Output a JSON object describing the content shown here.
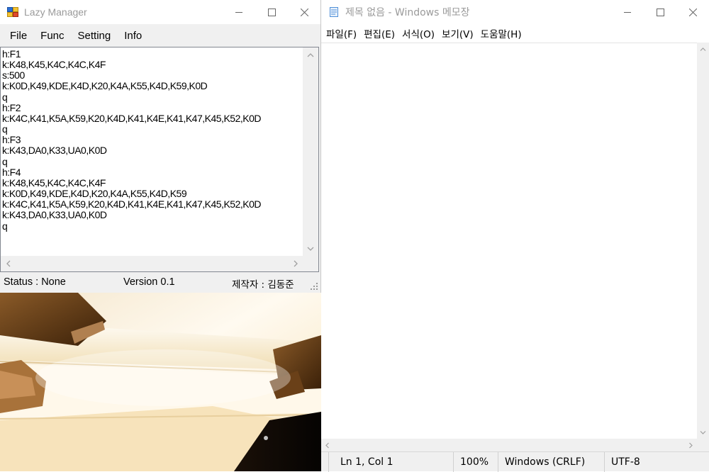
{
  "lazy_manager": {
    "title": "Lazy Manager",
    "menu": [
      "File",
      "Func",
      "Setting",
      "Info"
    ],
    "script_text": "h:F1\nk:K48,K45,K4C,K4C,K4F\ns:500\nk:K0D,K49,KDE,K4D,K20,K4A,K55,K4D,K59,K0D\nq\nh:F2\nk:K4C,K41,K5A,K59,K20,K4D,K41,K4E,K41,K47,K45,K52,K0D\nq\nh:F3\nk:K43,DA0,K33,UA0,K0D\nq\nh:F4\nk:K48,K45,K4C,K4C,K4F\nk:K0D,K49,KDE,K4D,K20,K4A,K55,K4D,K59\nk:K4C,K41,K5A,K59,K20,K4D,K41,K4E,K41,K47,K45,K52,K0D\nk:K43,DA0,K33,UA0,K0D\nq",
    "status": {
      "status_text": "Status :  None",
      "version_text": "Version 0.1",
      "author_text": "제작자 : 김동준"
    }
  },
  "notepad": {
    "title": "제목 없음 - Windows 메모장",
    "menu": [
      "파일(F)",
      "편집(E)",
      "서식(O)",
      "보기(V)",
      "도움말(H)"
    ],
    "content": "",
    "status": {
      "position": "Ln 1, Col 1",
      "zoom": "100%",
      "line_ending": "Windows (CRLF)",
      "encoding": "UTF-8"
    }
  },
  "colors": {
    "titlebar_text": "#9a9a9a",
    "chrome_bg": "#f0f0f0",
    "notepad_icon": "#4f8fd8"
  },
  "icons": {
    "lm_app": "app-window-icon",
    "np_app": "notepad-icon",
    "minimize": "minimize-icon",
    "maximize": "maximize-icon",
    "close": "close-icon"
  }
}
